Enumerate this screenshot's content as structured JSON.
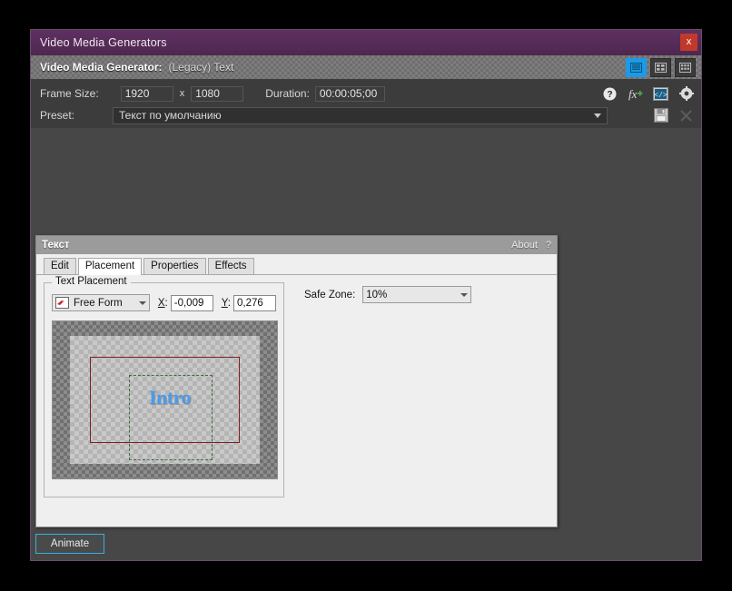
{
  "window": {
    "title": "Video Media Generators",
    "close_label": "x"
  },
  "generator_bar": {
    "label": "Video Media Generator:",
    "value": "(Legacy) Text",
    "view_modes": [
      {
        "name": "list-view",
        "active": true
      },
      {
        "name": "medium-grid-view",
        "active": false
      },
      {
        "name": "large-grid-view",
        "active": false
      }
    ]
  },
  "fields": {
    "frame_size_label": "Frame Size:",
    "frame_width": "1920",
    "frame_separator": "x",
    "frame_height": "1080",
    "duration_label": "Duration:",
    "duration_value": "00:00:05;00",
    "preset_label": "Preset:",
    "preset_value": "Текст по умолчанию"
  },
  "toolbar_icons": [
    {
      "name": "help-icon",
      "glyph": "?"
    },
    {
      "name": "fx-icon",
      "glyph": "fx"
    },
    {
      "name": "code-icon",
      "glyph": "</>"
    },
    {
      "name": "gear-icon",
      "glyph": "gear"
    },
    {
      "name": "save-icon",
      "glyph": "floppy"
    },
    {
      "name": "delete-icon",
      "glyph": "x"
    }
  ],
  "inner_dialog": {
    "title": "Текст",
    "about_label": "About",
    "help_label": "?",
    "tabs": [
      {
        "label": "Edit",
        "active": false
      },
      {
        "label": "Placement",
        "active": true
      },
      {
        "label": "Properties",
        "active": false
      },
      {
        "label": "Effects",
        "active": false
      }
    ],
    "placement": {
      "group_title": "Text Placement",
      "mode_value": "Free Form",
      "x_label": "X:",
      "x_value": "-0,009",
      "y_label": "Y:",
      "y_value": "0,276",
      "safe_zone_label": "Safe Zone:",
      "safe_zone_value": "10%",
      "preview_text": "Intro"
    }
  },
  "footer": {
    "animate_label": "Animate"
  },
  "colors": {
    "titlebar": "#5c2f5c",
    "accent_blue": "#1a9ae8",
    "close_red": "#c0392b",
    "text_blue": "#4d9ae8",
    "safe_zone_red": "#7e1f1f",
    "selection_green": "#3f6b3f",
    "window_bg": "#3c3c3c"
  }
}
